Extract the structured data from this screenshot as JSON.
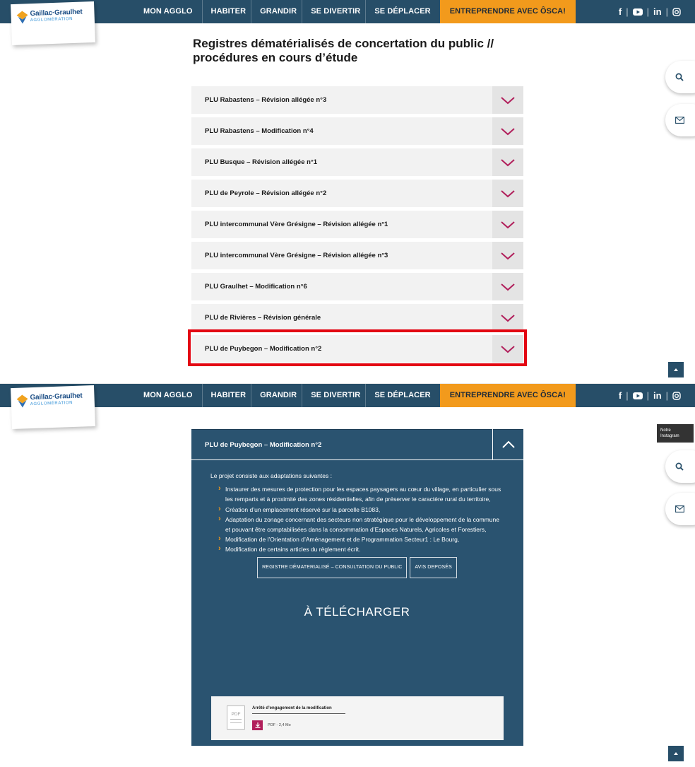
{
  "header": {
    "logo_name": "Gaillac·Graulhet",
    "logo_sub": "AGGLOMÉRATION",
    "nav": [
      "MON AGGLO",
      "HABITER",
      "GRANDIR",
      "SE DIVERTIR",
      "SE DÉPLACER"
    ],
    "cta": "ENTREPRENDRE AVEC ÔSCA!",
    "socials": [
      "f",
      "▶",
      "in",
      "◎"
    ],
    "separator": "|",
    "colors": {
      "nav_bg": "#274e68",
      "cta_bg": "#f29a1c",
      "accent": "#b11f5b"
    }
  },
  "page": {
    "title": "Registres dématérialisés de concertation du public // procédures en cours d’étude"
  },
  "accordion": {
    "items": [
      "PLU Rabastens – Révision allégée n°3",
      "PLU Rabastens – Modification n°4",
      "PLU Busque – Révision allégée n°1",
      "PLU de Peyrole – Révision allégée n°2",
      "PLU intercommunal Vère Grésigne – Révision allégée n°1",
      "PLU intercommunal Vère Grésigne – Révision allégée n°3",
      "PLU Graulhet – Modification n°6",
      "PLU de Rivières – Révision générale",
      "PLU de Puybegon – Modification n°2"
    ]
  },
  "expanded": {
    "title": "PLU de Puybegon – Modification n°2",
    "intro": "Le projet consiste aux adaptations suivantes :",
    "bullets": [
      "Instaurer des mesures de protection pour les espaces paysagers au cœur du village, en particulier sous les remparts et à proximité des zones résidentielles, afin de préserver le caractère rural du territoire,",
      "Création d’un emplacement réservé sur la parcelle B1083,",
      "Adaptation du zonage concernant des secteurs non stratégique pour le développement de la commune et pouvant être comptabilisées dans la consommation d’Espaces Naturels, Agricoles et Forestiers,",
      "Modification de l’Orientation d’Aménagement et de Programmation Secteur1 : Le Bourg,",
      "Modification de certains articles du règlement écrit."
    ],
    "buttons": [
      "REGISTRE DÉMATERIALISÉ – CONSULTATION DU PUBLIC",
      "AVIS DEPOSÉS"
    ],
    "download_title": "À TÉLÉCHARGER",
    "file": {
      "name": "Arrêté d’engagement de la modification",
      "icon_label": "PDF",
      "meta": "PDF - 2,4 Mo"
    }
  },
  "tooltip": {
    "line1": "Notre",
    "line2": "Instagram"
  },
  "icons": {
    "search": "search-icon",
    "mail": "mail-icon",
    "up": "chevron-up-icon"
  }
}
